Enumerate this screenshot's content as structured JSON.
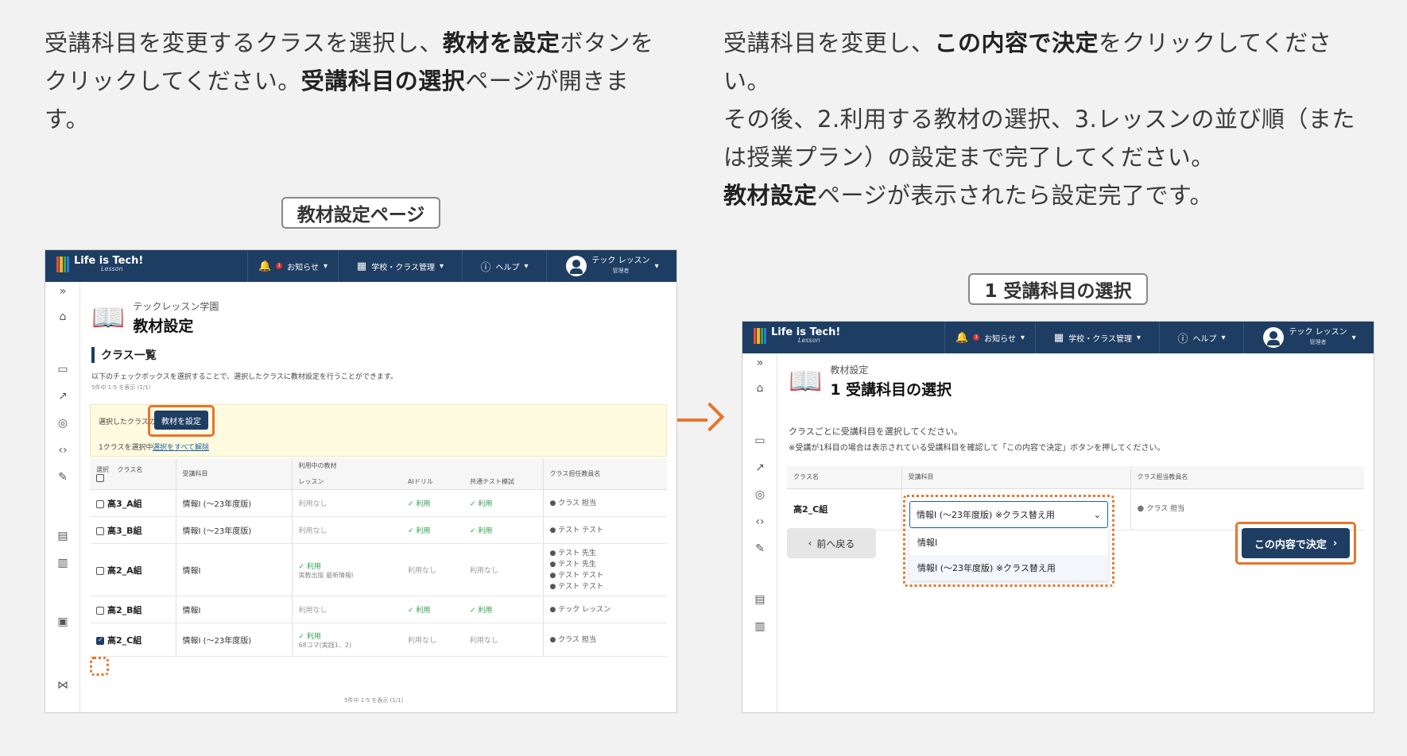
{
  "instructions": {
    "left": {
      "p1": "受講科目を変更するクラスを選択し、",
      "b1": "教材を設定",
      "p2": "ボタンをクリックしてください。",
      "b2": "受講科目の選択",
      "p3": "ページが開きます。"
    },
    "right": {
      "p1": "受講科目を変更し、",
      "b1": "この内容で決定",
      "p2": "をクリックしてください。",
      "p3": "その後、2.利用する教材の選択、3.レッスンの並び順（または授業プラン）の設定まで完了してください。",
      "b2": "教材設定",
      "p4": "ページが表示されたら設定完了です。"
    }
  },
  "tags": {
    "left": "教材設定ページ",
    "right": "1 受講科目の選択"
  },
  "header": {
    "logo": "Life is Tech!",
    "logo_sub": "Lesson",
    "notice": "お知らせ",
    "notice_badge": "1",
    "school": "学校・クラス管理",
    "help": "ヘルプ",
    "user_name": "テック レッスン",
    "user_role": "管理者"
  },
  "left_screen": {
    "school_name": "テックレッスン学園",
    "page_title": "教材設定",
    "section_title": "クラス一覧",
    "description": "以下のチェックボックスを選択することで、選択したクラスに教材設定を行うことができます。",
    "count_top": "5件中 1-5 を表示 (1/1)",
    "selected_label": "選択したクラスの",
    "set_button": "教材を設定",
    "selecting": "1クラスを選択中",
    "clear_all": "選択をすべて解除",
    "columns": {
      "select": "選択",
      "class_name": "クラス名",
      "subject": "受講科目",
      "materials_in_use": "利用中の教材",
      "lesson": "レッスン",
      "ai_drill": "AIドリル",
      "common_test": "共通テスト模試",
      "teachers": "クラス担任教員名"
    },
    "rows": [
      {
        "cls": "高3_A組",
        "subject": "情報Ⅰ (〜23年度版)",
        "lesson": "利用なし",
        "lesson_sub": "",
        "ai": "利用",
        "test": "利用",
        "teachers": [
          "クラス 担当"
        ],
        "checked": false
      },
      {
        "cls": "高3_B組",
        "subject": "情報Ⅰ (〜23年度版)",
        "lesson": "利用なし",
        "lesson_sub": "",
        "ai": "利用",
        "test": "利用",
        "teachers": [
          "テスト テスト"
        ],
        "checked": false
      },
      {
        "cls": "高2_A組",
        "subject": "情報Ⅰ",
        "lesson": "利用",
        "lesson_sub": "実教出版 最新情報Ⅰ",
        "ai": "利用なし",
        "test": "利用なし",
        "teachers": [
          "テスト 先生",
          "テスト 先生",
          "テスト テスト",
          "テスト テスト"
        ],
        "checked": false
      },
      {
        "cls": "高2_B組",
        "subject": "情報Ⅰ",
        "lesson": "利用なし",
        "lesson_sub": "",
        "ai": "利用",
        "test": "利用",
        "teachers": [
          "テック レッスン"
        ],
        "checked": false
      },
      {
        "cls": "高2_C組",
        "subject": "情報Ⅰ (〜23年度版)",
        "lesson": "利用",
        "lesson_sub": "68コマ(実践1、2)",
        "ai": "利用なし",
        "test": "利用なし",
        "teachers": [
          "クラス 担当"
        ],
        "checked": true
      }
    ],
    "count_bottom": "5件中 1-5 を表示 (1/1)"
  },
  "right_screen": {
    "breadcrumb": "教材設定",
    "page_title": "1 受講科目の選択",
    "desc1": "クラスごとに受講科目を選択してください。",
    "desc2": "※受講が1科目の場合は表示されている受講科目を確認して「この内容で決定」ボタンを押してください。",
    "columns": {
      "class_name": "クラス名",
      "subject": "受講科目",
      "teacher": "クラス担当教員名"
    },
    "row": {
      "cls": "高2_C組",
      "teacher": "クラス 担当"
    },
    "select_value": "情報Ⅰ (〜23年度版) ※クラス替え用",
    "options": [
      "情報Ⅰ",
      "情報Ⅰ (〜23年度版) ※クラス替え用"
    ],
    "back_button": "前へ戻る",
    "confirm_button": "この内容で決定"
  },
  "colors": {
    "navy": "#1e3d63",
    "accent": "#e8742c",
    "ok": "#2e9d4a"
  }
}
